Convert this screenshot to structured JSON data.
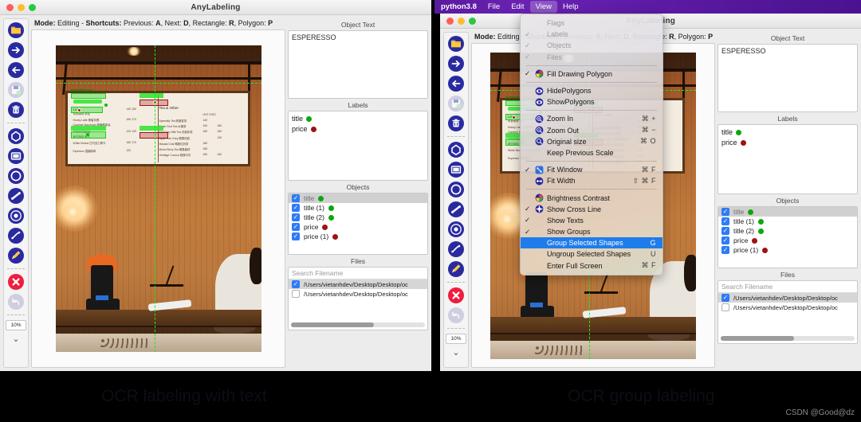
{
  "windows": {
    "left": {
      "title": "AnyLabeling",
      "mode_bar": {
        "segments": [
          {
            "text": "Mode:",
            "bold": true
          },
          {
            "text": " Editing - ",
            "bold": false
          },
          {
            "text": "Shortcuts:",
            "bold": true
          },
          {
            "text": " Previous: ",
            "bold": false
          },
          {
            "text": "A",
            "bold": true
          },
          {
            "text": ", Next: ",
            "bold": false
          },
          {
            "text": "D",
            "bold": true
          },
          {
            "text": ", Rectangle: ",
            "bold": false
          },
          {
            "text": "R",
            "bold": true
          },
          {
            "text": ", Polygon: ",
            "bold": false
          },
          {
            "text": "P",
            "bold": true
          }
        ],
        "plain": "Mode: Editing - Shortcuts: Previous: A, Next: D, Rectangle: R, Polygon: P"
      }
    },
    "right": {
      "title": "AnyLabeling",
      "mode_bar": {
        "plain": "Mode: Editing - Shortcuts: Previous: A, Next: D, Rectangle: R, Polygon: P"
      }
    }
  },
  "menubar": {
    "app": "python3.8",
    "items": [
      "File",
      "Edit",
      "View",
      "Help"
    ],
    "active": "View"
  },
  "view_menu": {
    "items": [
      {
        "label": "Flags",
        "checked": false,
        "disabled": true,
        "icon": "",
        "shortcut": "",
        "highlight": false
      },
      {
        "label": "Labels",
        "checked": true,
        "disabled": true,
        "icon": "",
        "shortcut": "",
        "highlight": false
      },
      {
        "label": "Objects",
        "checked": true,
        "disabled": true,
        "icon": "",
        "shortcut": "",
        "highlight": false
      },
      {
        "label": "Files",
        "checked": true,
        "disabled": true,
        "icon": "",
        "shortcut": "",
        "highlight": false
      },
      {
        "separator": true
      },
      {
        "label": "Fill Drawing Polygon",
        "checked": true,
        "disabled": false,
        "icon": "color-wheel-icon",
        "shortcut": "",
        "highlight": false
      },
      {
        "separator": true
      },
      {
        "label": "HidePolygons",
        "checked": false,
        "disabled": false,
        "icon": "eye-icon",
        "shortcut": "",
        "highlight": false
      },
      {
        "label": "ShowPolygons",
        "checked": false,
        "disabled": false,
        "icon": "eye-icon",
        "shortcut": "",
        "highlight": false
      },
      {
        "separator": true
      },
      {
        "label": "Zoom In",
        "checked": false,
        "disabled": false,
        "icon": "zoom-in-icon",
        "shortcut": "⌘ +",
        "highlight": false
      },
      {
        "label": "Zoom Out",
        "checked": false,
        "disabled": false,
        "icon": "zoom-out-icon",
        "shortcut": "⌘ −",
        "highlight": false
      },
      {
        "label": "Original size",
        "checked": false,
        "disabled": false,
        "icon": "zoom-reset-icon",
        "shortcut": "⌘ O",
        "highlight": false
      },
      {
        "label": "Keep Previous Scale",
        "checked": false,
        "disabled": false,
        "icon": "",
        "shortcut": "",
        "highlight": false
      },
      {
        "separator": true
      },
      {
        "label": "Fit Window",
        "checked": true,
        "disabled": false,
        "icon": "fit-window-icon",
        "shortcut": "⌘ F",
        "highlight": false
      },
      {
        "label": "Fit Width",
        "checked": false,
        "disabled": false,
        "icon": "fit-width-icon",
        "shortcut": "⇧ ⌘ F",
        "highlight": false
      },
      {
        "separator": true
      },
      {
        "label": "Brightness Contrast",
        "checked": false,
        "disabled": false,
        "icon": "brightness-icon",
        "shortcut": "",
        "highlight": false
      },
      {
        "label": "Show Cross Line",
        "checked": true,
        "disabled": false,
        "icon": "crosshair-icon",
        "shortcut": "",
        "highlight": false
      },
      {
        "label": "Show Texts",
        "checked": true,
        "disabled": false,
        "icon": "",
        "shortcut": "",
        "highlight": false
      },
      {
        "label": "Show Groups",
        "checked": true,
        "disabled": false,
        "icon": "",
        "shortcut": "",
        "highlight": false
      },
      {
        "label": "Group Selected Shapes",
        "checked": false,
        "disabled": false,
        "icon": "",
        "shortcut": "G",
        "highlight": true
      },
      {
        "label": "Ungroup Selected Shapes",
        "checked": false,
        "disabled": false,
        "icon": "",
        "shortcut": "U",
        "highlight": false
      },
      {
        "label": "Enter Full Screen",
        "checked": false,
        "disabled": false,
        "icon": "",
        "shortcut": "⌘ F",
        "highlight": false
      }
    ]
  },
  "toolbar": {
    "zoom_percent": "10%",
    "buttons": [
      {
        "name": "open-folder-icon",
        "enabled": true
      },
      {
        "name": "next-image-icon",
        "enabled": true
      },
      {
        "name": "prev-image-icon",
        "enabled": true
      },
      {
        "name": "save-icon",
        "enabled": false
      },
      {
        "name": "delete-icon",
        "enabled": true
      },
      {
        "name": "polygon-icon",
        "enabled": true
      },
      {
        "name": "rectangle-icon",
        "enabled": true
      },
      {
        "name": "circle-icon",
        "enabled": true
      },
      {
        "name": "line-icon",
        "enabled": true
      },
      {
        "name": "point-icon",
        "enabled": true
      },
      {
        "name": "linestrip-icon",
        "enabled": true
      },
      {
        "name": "edit-icon",
        "enabled": true
      },
      {
        "name": "cancel-icon",
        "enabled": true
      },
      {
        "name": "undo-icon",
        "enabled": false
      }
    ],
    "expand": "⌄⌄"
  },
  "dock": {
    "object_text": {
      "label": "Object Text",
      "value": "ESPERESSO"
    },
    "labels": {
      "label": "Labels",
      "items": [
        {
          "name": "title",
          "color": "#0aa80a"
        },
        {
          "name": "price",
          "color": "#9e1212"
        }
      ]
    },
    "objects": {
      "label": "Objects",
      "items": [
        {
          "name": "title",
          "color": "#0aa80a",
          "checked": true,
          "selected": true
        },
        {
          "name": "title (1)",
          "color": "#0aa80a",
          "checked": true,
          "selected": false
        },
        {
          "name": "title (2)",
          "color": "#0aa80a",
          "checked": true,
          "selected": false
        },
        {
          "name": "price",
          "color": "#9e1212",
          "checked": true,
          "selected": false
        },
        {
          "name": "price (1)",
          "color": "#9e1212",
          "checked": true,
          "selected": false
        }
      ]
    },
    "files": {
      "label": "Files",
      "search_placeholder": "Search Filename",
      "items": [
        {
          "path": "/Users/vietanhdev/Desktop/Desktop/oc",
          "checked": true,
          "selected": true
        },
        {
          "path": "/Users/vietanhdev/Desktop/Desktop/oc",
          "checked": false,
          "selected": false
        }
      ]
    }
  },
  "board": {
    "left_column": [
      {
        "text": "Latte",
        "style": "big"
      },
      {
        "text": "拿铁咖啡 拿鐵",
        "style": "sub"
      },
      {
        "text": "Honey Latte 蜂蜜拿鐵",
        "style": "row"
      },
      {
        "text": "Caramel Macchiato 焦糖瑪奇朵",
        "style": "sub"
      },
      {
        "text": "Americano",
        "style": "big"
      },
      {
        "text": "美式咖啡 美式",
        "style": "sub"
      },
      {
        "text": "White Mocha 白巧克力摩卡",
        "style": "row"
      },
      {
        "text": "Espresso 濃縮咖啡",
        "style": "row"
      }
    ],
    "left_prices": [
      "140  150",
      "160   170",
      "120  130",
      "160   170",
      "120"
    ],
    "right_title": "Tea & Other",
    "right_headers": [
      "HOT",
      "ICED"
    ],
    "right_rows": [
      {
        "name": "Specialty Tea 精選茗茶",
        "hot": "140",
        "iced": ""
      },
      {
        "name": "Fresh Fruit Tea 水果茶",
        "hot": "160",
        "iced": "160"
      },
      {
        "name": "Earl Grey Milk Tea 伯爵奶茶",
        "hot": "160",
        "iced": "160"
      },
      {
        "name": "Apple Earl Grey 蘋果伯爵",
        "hot": "",
        "iced": "140"
      },
      {
        "name": "Masala Chai 瑪薩拉奶茶",
        "hot": "180",
        "iced": ""
      },
      {
        "name": "Mixed Berry Tea 莓果森林",
        "hot": "180",
        "iced": ""
      },
      {
        "name": "Heritage Cococa 經典可可",
        "hot": "160",
        "iced": "160"
      }
    ],
    "annotations": [
      {
        "label": "ESPERESSO",
        "type": "title"
      },
      {
        "label": "ESPERESSO",
        "type": "title"
      },
      {
        "label": "Americano",
        "type": "title"
      }
    ]
  },
  "captions": {
    "left": "OCR labeling with text",
    "right": "OCR group labeling"
  },
  "watermark": "CSDN @Good@dz",
  "colors": {
    "accent_purple": "#5a1a9e",
    "highlight_blue": "#1f7ceb",
    "title_green": "#0aa80a",
    "price_red": "#9e1212",
    "toolbar_navy": "#2a2a9c"
  }
}
